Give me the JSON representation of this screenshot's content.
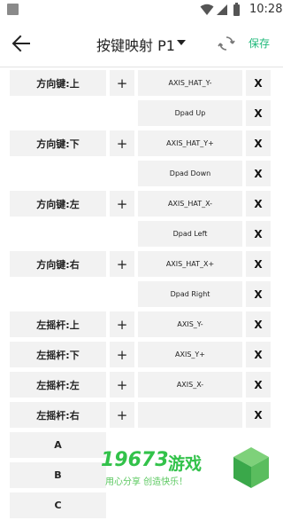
{
  "status_bar": {
    "time": "10:28"
  },
  "app_bar": {
    "title": "按键映射 P1",
    "save_label": "保存"
  },
  "rows": [
    {
      "key": "方向键:上",
      "axis": "AXIS_HAT_Y-",
      "x": "X",
      "plus": "+"
    },
    {
      "key": "",
      "axis": "Dpad Up",
      "x": "X",
      "plus": ""
    },
    {
      "key": "方向键:下",
      "axis": "AXIS_HAT_Y+",
      "x": "X",
      "plus": "+"
    },
    {
      "key": "",
      "axis": "Dpad Down",
      "x": "X",
      "plus": ""
    },
    {
      "key": "方向键:左",
      "axis": "AXIS_HAT_X-",
      "x": "X",
      "plus": "+"
    },
    {
      "key": "",
      "axis": "Dpad Left",
      "x": "X",
      "plus": ""
    },
    {
      "key": "方向键:右",
      "axis": "AXIS_HAT_X+",
      "x": "X",
      "plus": "+"
    },
    {
      "key": "",
      "axis": "Dpad Right",
      "x": "X",
      "plus": ""
    },
    {
      "key": "左摇杆:上",
      "axis": "AXIS_Y-",
      "x": "X",
      "plus": "+"
    },
    {
      "key": "左摇杆:下",
      "axis": "AXIS_Y+",
      "x": "X",
      "plus": "+"
    },
    {
      "key": "左摇杆:左",
      "axis": "AXIS_X-",
      "x": "X",
      "plus": "+"
    },
    {
      "key": "左摇杆:右",
      "axis": "",
      "x": "X",
      "plus": "+"
    },
    {
      "key": "A",
      "axis": "",
      "x": "",
      "plus": ""
    },
    {
      "key": "B",
      "axis": "",
      "x": "",
      "plus": ""
    },
    {
      "key": "C",
      "axis": "",
      "x": "",
      "plus": ""
    }
  ],
  "watermark": {
    "number": "19673",
    "name": "游戏",
    "slogan": "用心分享 创造快乐！"
  }
}
